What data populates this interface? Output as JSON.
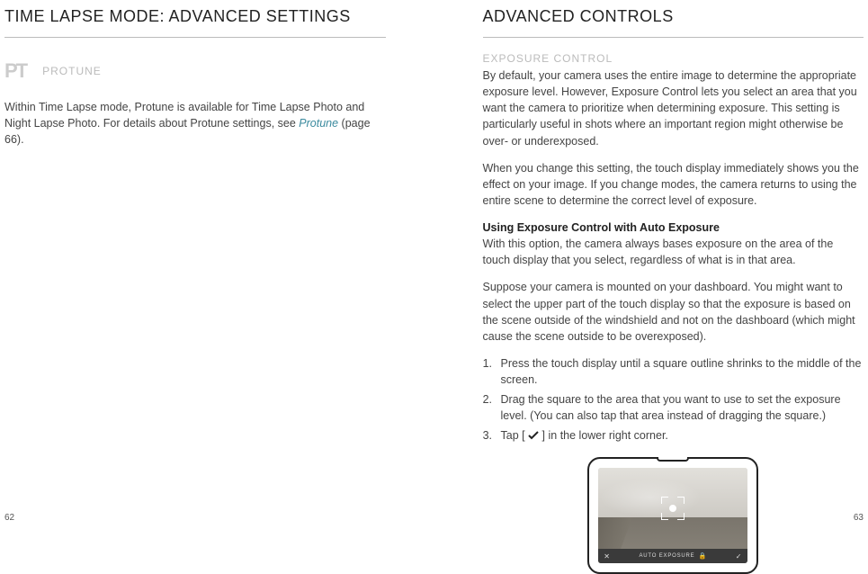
{
  "left": {
    "title": "TIME LAPSE MODE: ADVANCED SETTINGS",
    "protune_label": "PROTUNE",
    "pt_glyph": "PT",
    "body_pre": "Within Time Lapse mode, Protune is available for Time Lapse Photo and Night Lapse Photo. For details about Protune settings, see ",
    "body_link": "Protune",
    "body_post": " (page 66).",
    "page_num": "62"
  },
  "right": {
    "title": "ADVANCED CONTROLS",
    "section": "EXPOSURE CONTROL",
    "para1": "By default, your camera uses the entire image to determine the appropriate exposure level. However, Exposure Control lets you select an area that you want the camera to prioritize when determining exposure. This setting is particularly useful in shots where an important region might otherwise be over- or underexposed.",
    "para2": "When you change this setting, the touch display immediately shows you the effect on your image. If you change modes, the camera returns to using the entire scene to determine the correct level of exposure.",
    "bold_heading": "Using Exposure Control with Auto Exposure",
    "para3": "With this option, the camera always bases exposure on the area of the touch display that you select, regardless of what is in that area.",
    "para4": "Suppose your camera is mounted on your dashboard. You might want to select the upper part of the touch display so that the exposure is based on the scene outside of the windshield and not on the dashboard (which might cause the scene outside to be overexposed).",
    "steps": [
      "Press the touch display until a square outline shrinks to the middle of the screen.",
      "Drag the square to the area that you want to use to set the exposure level. (You can also tap that area instead of dragging the square.)"
    ],
    "step3_pre": "Tap [ ",
    "step3_post": " ] in the lower right corner.",
    "status_label": "AUTO EXPOSURE",
    "page_num": "63"
  }
}
